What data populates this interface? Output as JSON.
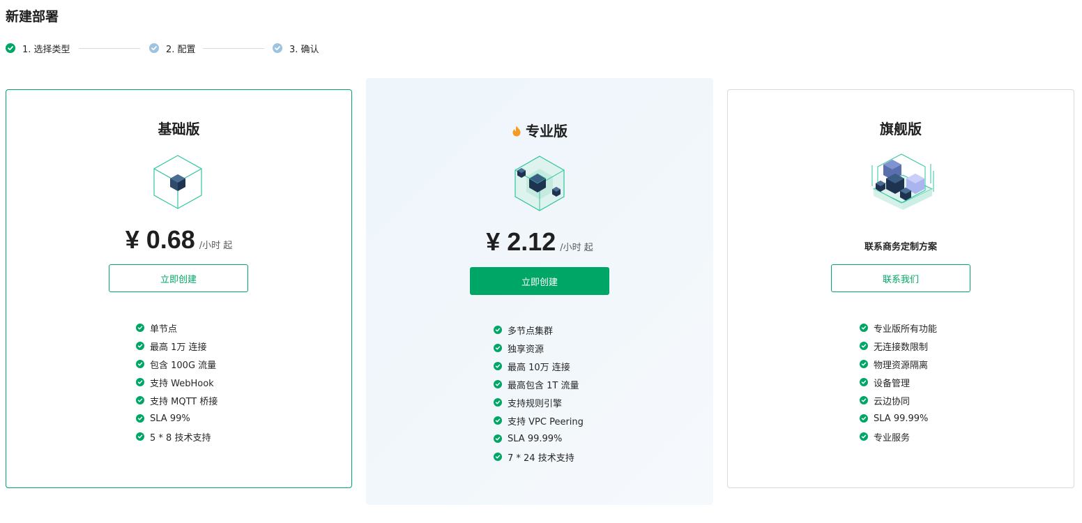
{
  "page": {
    "title": "新建部署"
  },
  "steps": [
    {
      "label": "1. 选择类型",
      "state": "done"
    },
    {
      "label": "2. 配置",
      "state": "pending"
    },
    {
      "label": "3. 确认",
      "state": "pending"
    }
  ],
  "colors": {
    "accent": "#00a665",
    "pending_step": "#9dc3e0",
    "pro_bg": "#eef5fb",
    "fire": "#f59a23"
  },
  "plans": {
    "basic": {
      "name": "基础版",
      "price": "¥ 0.68",
      "unit": "/小时 起",
      "button": "立即创建",
      "features": [
        "单节点",
        "最高 1万 连接",
        "包含 100G 流量",
        "支持 WebHook",
        "支持 MQTT 桥接",
        "SLA 99%",
        "5 * 8 技术支持"
      ]
    },
    "pro": {
      "name": "专业版",
      "badge_icon": "fire-icon",
      "price": "¥ 2.12",
      "unit": "/小时 起",
      "button": "立即创建",
      "features": [
        "多节点集群",
        "独享资源",
        "最高 10万 连接",
        "最高包含 1T 流量",
        "支持规则引擎",
        "支持 VPC Peering",
        "SLA 99.99%",
        "7 * 24 技术支持"
      ]
    },
    "flagship": {
      "name": "旗舰版",
      "contact_text": "联系商务定制方案",
      "button": "联系我们",
      "features": [
        "专业版所有功能",
        "无连接数限制",
        "物理资源隔离",
        "设备管理",
        "云边协同",
        "SLA 99.99%",
        "专业服务"
      ]
    }
  }
}
